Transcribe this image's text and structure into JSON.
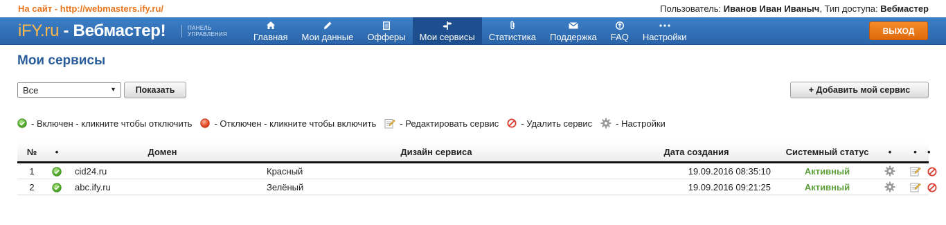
{
  "topbar": {
    "site_link": "На сайт - http://webmasters.ify.ru/",
    "user_label": "Пользователь:",
    "user_name": "Иванов Иван Иваныч",
    "access_label": ", Тип доступа:",
    "access_value": "Вебмастер"
  },
  "header": {
    "logo_ify": "iFY.ru",
    "logo_rest": " - Вебмастер!",
    "logo_sub_1": "ПАНЕЛЬ",
    "logo_sub_2": "УПРАВЛЕНИЯ",
    "nav": [
      {
        "label": "Главная",
        "icon": "home-icon"
      },
      {
        "label": "Мои данные",
        "icon": "pencil-icon"
      },
      {
        "label": "Офферы",
        "icon": "document-icon"
      },
      {
        "label": "Мои сервисы",
        "icon": "signpost-icon"
      },
      {
        "label": "Статистика",
        "icon": "paperclip-icon"
      },
      {
        "label": "Поддержка",
        "icon": "envelope-icon"
      },
      {
        "label": "FAQ",
        "icon": "info-icon"
      },
      {
        "label": "Настройки",
        "icon": "dots-icon"
      }
    ],
    "active_nav": "Мои сервисы",
    "exit_label": "ВЫХОД"
  },
  "main": {
    "title": "Мои сервисы",
    "filter_value": "Все",
    "show_button": "Показать",
    "add_button": "+ Добавить мой сервис"
  },
  "legend": [
    {
      "icon": "green-check-icon",
      "text": "- Включен - кликните чтобы отключить"
    },
    {
      "icon": "red-dot-icon",
      "text": "- Отключен - кликните чтобы включить"
    },
    {
      "icon": "edit-icon",
      "text": "- Редактировать сервис"
    },
    {
      "icon": "delete-icon",
      "text": "- Удалить сервис"
    },
    {
      "icon": "gear-icon",
      "text": "- Настройки"
    }
  ],
  "table": {
    "headers": {
      "num": "№",
      "dot1": "•",
      "domain": "Домен",
      "design": "Дизайн сервиса",
      "created": "Дата создания",
      "status": "Системный статус",
      "dot2": "•",
      "dot3": "•",
      "dot4": "•"
    },
    "rows": [
      {
        "num": "1",
        "domain": "cid24.ru",
        "design": "Красный",
        "created": "19.09.2016 08:35:10",
        "status": "Активный"
      },
      {
        "num": "2",
        "domain": "abc.ify.ru",
        "design": "Зелёный",
        "created": "19.09.2016 09:21:25",
        "status": "Активный"
      }
    ]
  },
  "colors": {
    "accent": "#2a63a8",
    "title": "#2a5d9a",
    "site_link": "#e8741c",
    "exit_button": "#e06a0c",
    "status_active": "#5d9f3a"
  }
}
